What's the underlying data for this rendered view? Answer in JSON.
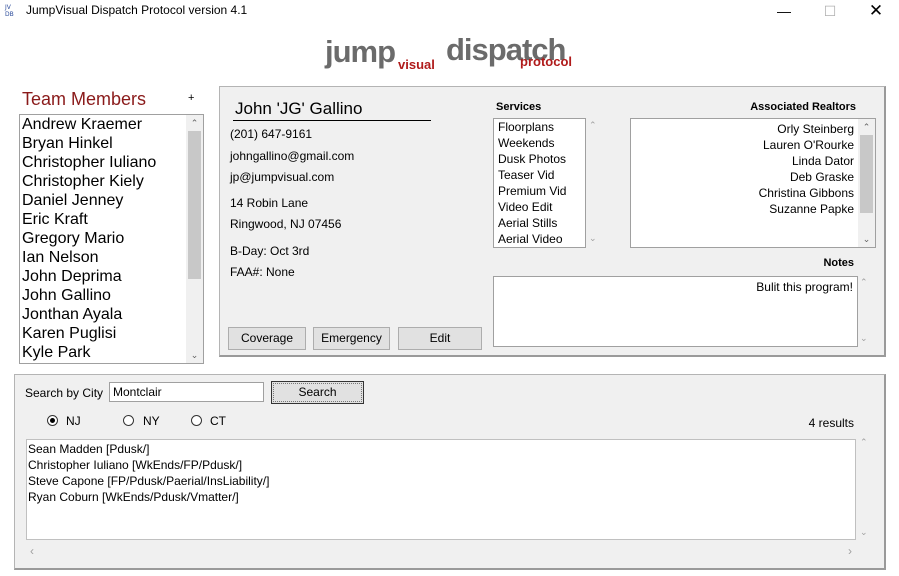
{
  "window": {
    "title": "JumpVisual Dispatch Protocol version 4.1",
    "icon_text": "JV\nDB",
    "minimize_icon": "minimize-icon",
    "maximize_icon": "maximize-icon",
    "close_icon": "close-icon"
  },
  "logo": {
    "jump": "jump",
    "visual": "visual",
    "dispatch": "dispatch",
    "protocol": "protocol",
    "colors": {
      "gray": "#6b6b6b",
      "red": "#b01b1b"
    }
  },
  "team": {
    "title": "Team Members",
    "add_label": "+",
    "members": [
      "Andrew Kraemer",
      "Bryan Hinkel",
      "Christopher Iuliano",
      "Christopher Kiely",
      "Daniel Jenney",
      "Eric Kraft",
      "Gregory Mario",
      "Ian Nelson",
      "John Deprima",
      "John Gallino",
      "Jonthan Ayala",
      "Karen Puglisi",
      "Kyle Park"
    ]
  },
  "contact": {
    "name": "John 'JG' Gallino",
    "phone": "(201) 647-9161",
    "email1": "johngallino@gmail.com",
    "email2": "jp@jumpvisual.com",
    "street": "14 Robin Lane",
    "city": "Ringwood, NJ 07456",
    "birthday": "B-Day: Oct 3rd",
    "faa": "FAA#: None"
  },
  "buttons": {
    "coverage": "Coverage",
    "emergency": "Emergency",
    "edit": "Edit",
    "search": "Search"
  },
  "services": {
    "label": "Services",
    "items": [
      "Floorplans",
      "Weekends",
      "Dusk Photos",
      "Teaser Vid",
      "Premium Vid",
      "Video Edit",
      "Aerial Stills",
      "Aerial Video"
    ]
  },
  "realtors": {
    "label": "Associated Realtors",
    "items": [
      "Orly Steinberg",
      "Lauren O'Rourke",
      "Linda Dator",
      "Deb Graske",
      "Christina Gibbons",
      "Suzanne Papke"
    ]
  },
  "notes": {
    "label": "Notes",
    "text": "Bulit this program!"
  },
  "search": {
    "label": "Search by City",
    "value": "Montclair",
    "states": [
      {
        "label": "NJ",
        "selected": true
      },
      {
        "label": "NY",
        "selected": false
      },
      {
        "label": "CT",
        "selected": false
      }
    ],
    "results_count": "4 results",
    "results": [
      "Sean Madden [Pdusk/]",
      "Christopher Iuliano [WkEnds/FP/Pdusk/]",
      "Steve Capone [FP/Pdusk/Paerial/InsLiability/]",
      "Ryan Coburn [WkEnds/Pdusk/Vmatter/]"
    ]
  }
}
